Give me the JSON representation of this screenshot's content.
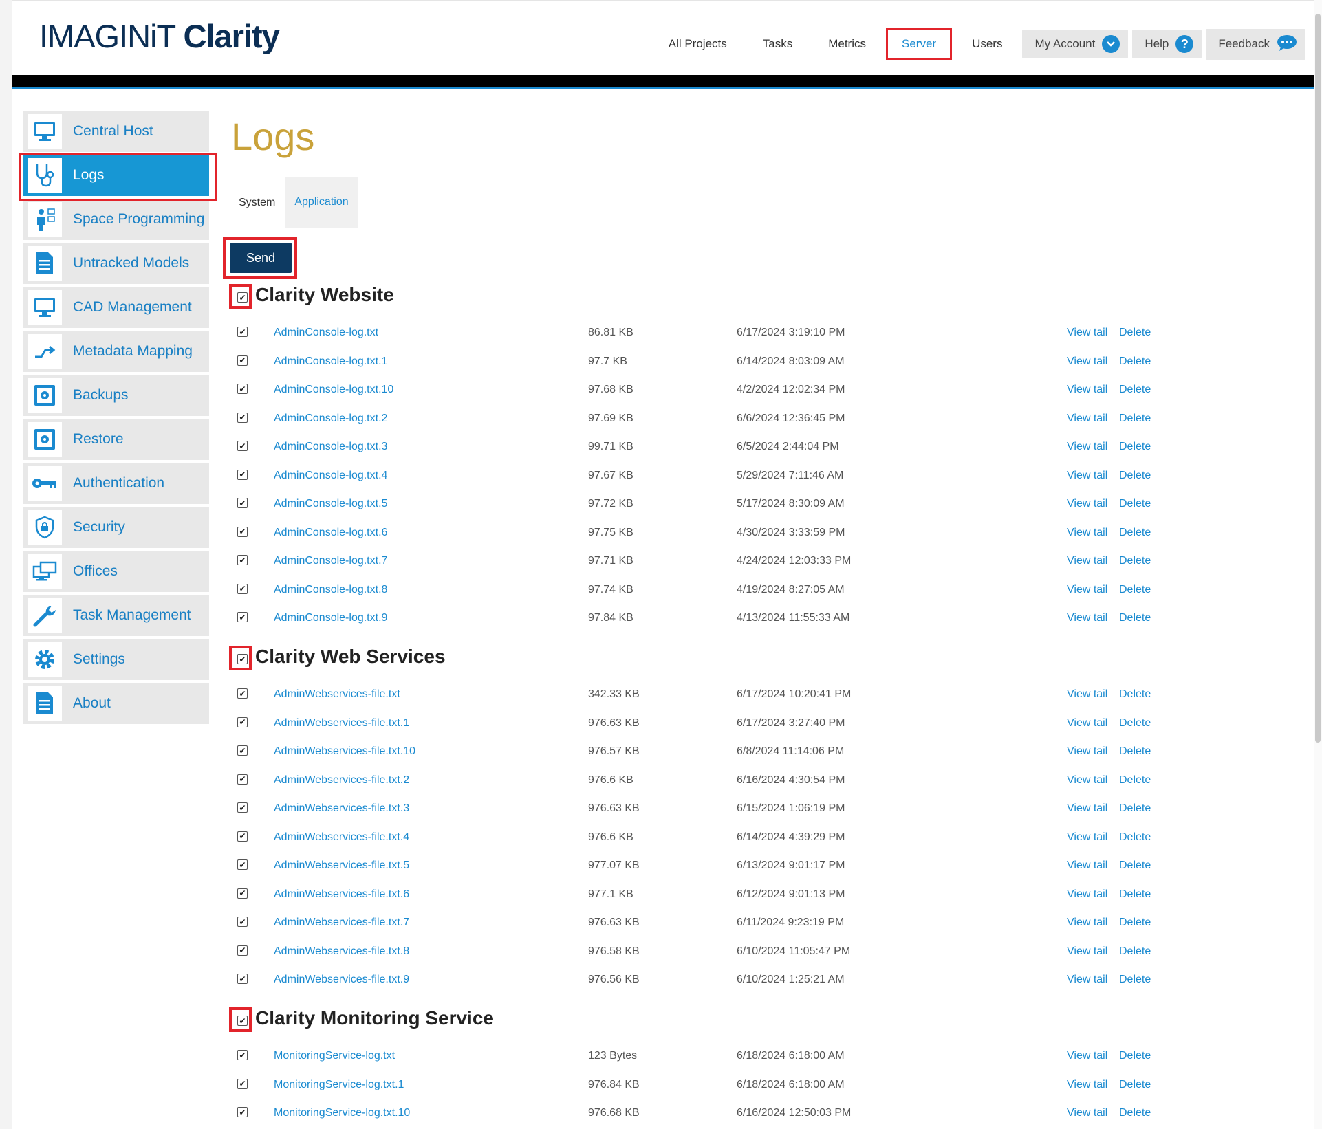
{
  "header": {
    "logo_part1": "IMAGINiT",
    "logo_part2": "Clarity",
    "nav": [
      {
        "label": "All Projects"
      },
      {
        "label": "Tasks"
      },
      {
        "label": "Metrics"
      },
      {
        "label": "Server"
      },
      {
        "label": "Users"
      }
    ],
    "my_account": "My Account",
    "help": "Help",
    "feedback": "Feedback"
  },
  "sidebar": {
    "items": [
      {
        "label": "Central Host",
        "icon": "monitor-icon"
      },
      {
        "label": "Logs",
        "icon": "stethoscope-icon"
      },
      {
        "label": "Space Programming",
        "icon": "space-programming-icon"
      },
      {
        "label": "Untracked Models",
        "icon": "document-icon"
      },
      {
        "label": "CAD Management",
        "icon": "monitor-icon"
      },
      {
        "label": "Metadata Mapping",
        "icon": "arrow-icon"
      },
      {
        "label": "Backups",
        "icon": "safe-icon"
      },
      {
        "label": "Restore",
        "icon": "safe-icon"
      },
      {
        "label": "Authentication",
        "icon": "key-icon"
      },
      {
        "label": "Security",
        "icon": "shield-icon"
      },
      {
        "label": "Offices",
        "icon": "offices-icon"
      },
      {
        "label": "Task Management",
        "icon": "wrench-icon"
      },
      {
        "label": "Settings",
        "icon": "gear-icon"
      },
      {
        "label": "About",
        "icon": "document-icon"
      }
    ]
  },
  "main": {
    "title": "Logs",
    "tabs": [
      {
        "label": "System"
      },
      {
        "label": "Application"
      }
    ],
    "send_label": "Send",
    "view_tail_label": "View tail",
    "delete_label": "Delete",
    "sections": [
      {
        "title": "Clarity Website",
        "files": [
          {
            "name": "AdminConsole-log.txt",
            "size": "86.81 KB",
            "date": "6/17/2024 3:19:10 PM"
          },
          {
            "name": "AdminConsole-log.txt.1",
            "size": "97.7 KB",
            "date": "6/14/2024 8:03:09 AM"
          },
          {
            "name": "AdminConsole-log.txt.10",
            "size": "97.68 KB",
            "date": "4/2/2024 12:02:34 PM"
          },
          {
            "name": "AdminConsole-log.txt.2",
            "size": "97.69 KB",
            "date": "6/6/2024 12:36:45 PM"
          },
          {
            "name": "AdminConsole-log.txt.3",
            "size": "99.71 KB",
            "date": "6/5/2024 2:44:04 PM"
          },
          {
            "name": "AdminConsole-log.txt.4",
            "size": "97.67 KB",
            "date": "5/29/2024 7:11:46 AM"
          },
          {
            "name": "AdminConsole-log.txt.5",
            "size": "97.72 KB",
            "date": "5/17/2024 8:30:09 AM"
          },
          {
            "name": "AdminConsole-log.txt.6",
            "size": "97.75 KB",
            "date": "4/30/2024 3:33:59 PM"
          },
          {
            "name": "AdminConsole-log.txt.7",
            "size": "97.71 KB",
            "date": "4/24/2024 12:03:33 PM"
          },
          {
            "name": "AdminConsole-log.txt.8",
            "size": "97.74 KB",
            "date": "4/19/2024 8:27:05 AM"
          },
          {
            "name": "AdminConsole-log.txt.9",
            "size": "97.84 KB",
            "date": "4/13/2024 11:55:33 AM"
          }
        ]
      },
      {
        "title": "Clarity Web Services",
        "files": [
          {
            "name": "AdminWebservices-file.txt",
            "size": "342.33 KB",
            "date": "6/17/2024 10:20:41 PM"
          },
          {
            "name": "AdminWebservices-file.txt.1",
            "size": "976.63 KB",
            "date": "6/17/2024 3:27:40 PM"
          },
          {
            "name": "AdminWebservices-file.txt.10",
            "size": "976.57 KB",
            "date": "6/8/2024 11:14:06 PM"
          },
          {
            "name": "AdminWebservices-file.txt.2",
            "size": "976.6 KB",
            "date": "6/16/2024 4:30:54 PM"
          },
          {
            "name": "AdminWebservices-file.txt.3",
            "size": "976.63 KB",
            "date": "6/15/2024 1:06:19 PM"
          },
          {
            "name": "AdminWebservices-file.txt.4",
            "size": "976.6 KB",
            "date": "6/14/2024 4:39:29 PM"
          },
          {
            "name": "AdminWebservices-file.txt.5",
            "size": "977.07 KB",
            "date": "6/13/2024 9:01:17 PM"
          },
          {
            "name": "AdminWebservices-file.txt.6",
            "size": "977.1 KB",
            "date": "6/12/2024 9:01:13 PM"
          },
          {
            "name": "AdminWebservices-file.txt.7",
            "size": "976.63 KB",
            "date": "6/11/2024 9:23:19 PM"
          },
          {
            "name": "AdminWebservices-file.txt.8",
            "size": "976.58 KB",
            "date": "6/10/2024 11:05:47 PM"
          },
          {
            "name": "AdminWebservices-file.txt.9",
            "size": "976.56 KB",
            "date": "6/10/2024 1:25:21 AM"
          }
        ]
      },
      {
        "title": "Clarity Monitoring Service",
        "files": [
          {
            "name": "MonitoringService-log.txt",
            "size": "123 Bytes",
            "date": "6/18/2024 6:18:00 AM"
          },
          {
            "name": "MonitoringService-log.txt.1",
            "size": "976.84 KB",
            "date": "6/18/2024 6:18:00 AM"
          },
          {
            "name": "MonitoringService-log.txt.10",
            "size": "976.68 KB",
            "date": "6/16/2024 12:50:03 PM"
          }
        ]
      }
    ]
  },
  "colors": {
    "accent": "#1a8ad0",
    "brand_navy": "#0b2e54",
    "title_gold": "#c9a23a",
    "highlight_red": "#e2242b",
    "send_button": "#0d3a62"
  }
}
